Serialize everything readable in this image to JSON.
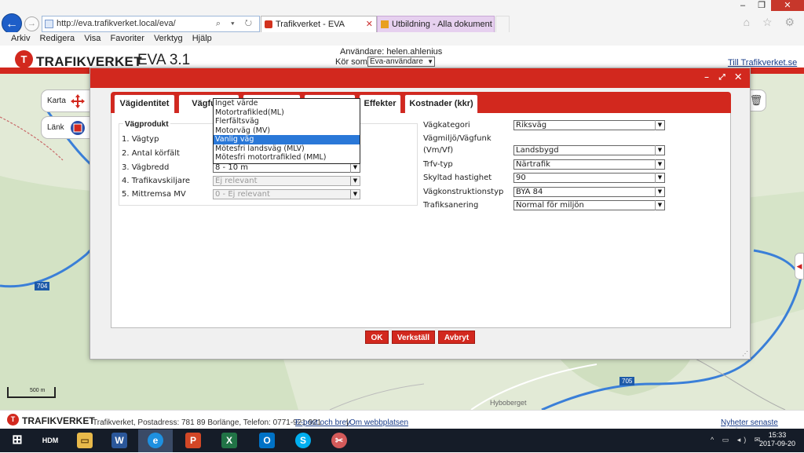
{
  "browser": {
    "address": "http://eva.trafikverket.local/eva/",
    "tabs": [
      {
        "title": "Trafikverket - EVA",
        "close": "✕"
      },
      {
        "title": "Utbildning - Alla dokument"
      }
    ],
    "menu": [
      "Arkiv",
      "Redigera",
      "Visa",
      "Favoriter",
      "Verktyg",
      "Hjälp"
    ],
    "window_controls": [
      "–",
      "❐",
      "✕"
    ],
    "toolbar_icons": "⌂ ☆ ⚙",
    "back_glyph": "←",
    "forward_glyph": "→",
    "address_controls": "⌕ ▾ ↻"
  },
  "header": {
    "logo": "TRAFIKVERKET",
    "app_name": "EVA 3.1",
    "user_label": "Användare: helen.ahlenius",
    "run_as_label": "Kör som:",
    "run_as_value": "Eva-användare",
    "link": "Till Trafikverket.se"
  },
  "map": {
    "buttons": [
      {
        "label": "Karta",
        "icon": "move-arrows-icon"
      },
      {
        "label": "Länk",
        "icon": "link-map-icon"
      }
    ],
    "road_labels": [
      "704",
      "705"
    ],
    "place_name": "Hyboberget",
    "scale": "500 m",
    "trash_glyph": "🗑",
    "side_glyph": "◀"
  },
  "modal": {
    "controls": "– ⤢ ✕",
    "tabs": [
      {
        "label": "Vägidentitet"
      },
      {
        "label": "Vägfunk"
      },
      {
        "label": ""
      },
      {
        "label": ""
      },
      {
        "label": "Effekter"
      },
      {
        "label": "Kostnader (kkr)"
      }
    ],
    "vagprodukt": {
      "title": "Vägprodukt",
      "rows": [
        {
          "label": "1. Vägtyp",
          "value": "",
          "disabled": false
        },
        {
          "label": "2. Antal körfält",
          "value": "",
          "disabled": false
        },
        {
          "label": "3. Vägbredd",
          "value": "8 - 10 m",
          "disabled": false
        },
        {
          "label": "4. Trafikavskiljare",
          "value": "Ej relevant",
          "disabled": true
        },
        {
          "label": "5. Mittremsa MV",
          "value": "0 - Ej relevant",
          "disabled": true
        }
      ]
    },
    "dropdown_options": [
      "Inget värde",
      "Motortrafikled(ML)",
      "Flerfältsväg",
      "Motorväg (MV)",
      "Vanlig väg",
      "Mötesfri landsväg (MLV)",
      "Mötesfri motortrafikled (MML)"
    ],
    "dropdown_selected": "Vanlig väg",
    "right_fields": [
      {
        "label": "Vägkategori",
        "value": "Riksväg"
      },
      {
        "label": "Vägmiljö/Vägfunk",
        "label2": "(Vm/Vf)",
        "value": "Landsbygd"
      },
      {
        "label": "Trfv-typ",
        "value": "Närtrafik"
      },
      {
        "label": "Skyltad hastighet",
        "value": "90"
      },
      {
        "label": "Vägkonstruktionstyp",
        "value": "BYA 84"
      },
      {
        "label": "Trafiksanering",
        "value": "Normal för miljön"
      }
    ],
    "buttons": {
      "ok": "OK",
      "apply": "Verkställ",
      "cancel": "Avbryt"
    },
    "resize_glyph": "⋰"
  },
  "footer": {
    "logo": "TRAFIKVERKET",
    "address": "Trafikverket, Postadress: 781 89 Borlänge, Telefon: 0771-921 921",
    "link_email": "E-post och brev",
    "separator": "|",
    "link_about": "Om webbplatsen",
    "news_link": "Nyheter senaste version"
  },
  "taskbar": {
    "apps": [
      {
        "name": "start",
        "glyph": "⊞"
      },
      {
        "name": "hdm",
        "glyph": "HDM"
      },
      {
        "name": "explorer",
        "glyph": "▭"
      },
      {
        "name": "word",
        "glyph": "W"
      },
      {
        "name": "ie",
        "glyph": "e"
      },
      {
        "name": "powerpoint",
        "glyph": "P"
      },
      {
        "name": "excel",
        "glyph": "X"
      },
      {
        "name": "outlook",
        "glyph": "O"
      },
      {
        "name": "skype",
        "glyph": "S"
      },
      {
        "name": "snipping",
        "glyph": "✂"
      }
    ],
    "tray": "^ ▭ ◂) ✉",
    "time": "15:33",
    "date": "2017-09-20"
  },
  "colors": {
    "brand_red": "#d2281e",
    "road_blue": "#3a7fd8",
    "selection_blue": "#2a78d8"
  }
}
